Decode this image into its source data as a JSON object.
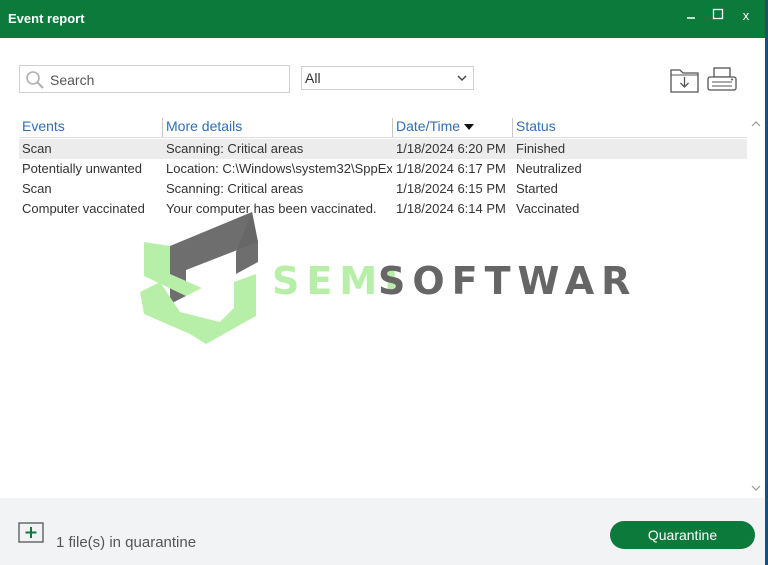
{
  "window": {
    "title": "Event report",
    "controls": {
      "minimize": "_",
      "maximize": "□",
      "close": "x"
    }
  },
  "toolbar": {
    "search": {
      "placeholder": "Search",
      "value": ""
    },
    "filter": {
      "selected": "All"
    },
    "export_icon": "save-to-folder-icon",
    "print_icon": "printer-icon"
  },
  "table": {
    "columns": [
      {
        "label": "Events"
      },
      {
        "label": "More details"
      },
      {
        "label": "Date/Time",
        "sorted": "descending"
      },
      {
        "label": "Status"
      }
    ],
    "rows": [
      {
        "event": "Scan",
        "details": "Scanning: Critical areas",
        "datetime": "1/18/2024 6:20 PM",
        "status": "Finished"
      },
      {
        "event": "Potentially unwanted",
        "details": "Location: C:\\Windows\\system32\\SppEx",
        "datetime": "1/18/2024 6:17 PM",
        "status": "Neutralized"
      },
      {
        "event": "Scan",
        "details": "Scanning: Critical areas",
        "datetime": "1/18/2024 6:15 PM",
        "status": "Started"
      },
      {
        "event": "Computer vaccinated",
        "details": "Your computer has been vaccinated.",
        "datetime": "1/18/2024 6:14 PM",
        "status": "Vaccinated"
      }
    ]
  },
  "watermark": {
    "brand_part1": "SEMI",
    "brand_part2": "SOFTWARES"
  },
  "footer": {
    "quarantine_count_text": "1 file(s) in quarantine",
    "quarantine_button": "Quarantine"
  },
  "colors": {
    "accent": "#0b7a3b",
    "header_link": "#2f6fb5",
    "selected_row": "#ececec",
    "footer_bg": "#f1f3f4",
    "watermark_green": "#b8efa8",
    "watermark_gray": "#666666"
  }
}
